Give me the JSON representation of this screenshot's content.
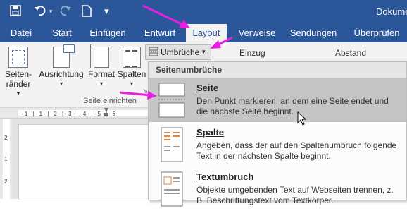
{
  "window": {
    "title": "Dokume"
  },
  "tabs": [
    {
      "label": "Datei",
      "active": false
    },
    {
      "label": "Start",
      "active": false
    },
    {
      "label": "Einfügen",
      "active": false
    },
    {
      "label": "Entwurf",
      "active": false
    },
    {
      "label": "Layout",
      "active": true
    },
    {
      "label": "Verweise",
      "active": false
    },
    {
      "label": "Sendungen",
      "active": false
    },
    {
      "label": "Überprüfen",
      "active": false
    }
  ],
  "ribbon": {
    "margins": {
      "line1": "Seiten-",
      "line2": "ränder"
    },
    "orientation": {
      "label": "Ausrichtung"
    },
    "size": {
      "label": "Format"
    },
    "columns": {
      "label": "Spalten"
    },
    "group_label": "Seite einrichten",
    "breaks_label": "Umbrüche",
    "indent_label": "Einzug",
    "spacing_label": "Abstand"
  },
  "menu": {
    "header": "Seitenumbrüche",
    "items": [
      {
        "title_first": "S",
        "title_rest": "eite",
        "desc": "Den Punkt markieren, an dem eine Seite endet und die nächste Seite beginnt.",
        "highlighted": true
      },
      {
        "title_first": "",
        "title_rest": "Spalte",
        "desc": "Angeben, dass der auf den Spaltenumbruch folgende Text in der nächsten Spalte beginnt.",
        "highlighted": false
      },
      {
        "title_first": "T",
        "title_rest": "extumbruch",
        "desc": "Objekte umgebenden Text auf Webseiten trennen, z. B. Beschriftungstext vom Textkörper.",
        "highlighted": false
      }
    ]
  },
  "colors": {
    "ribbon_blue": "#2b579a",
    "annotation_arrow": "#e81ee0",
    "highlight": "#c5c5c5"
  }
}
